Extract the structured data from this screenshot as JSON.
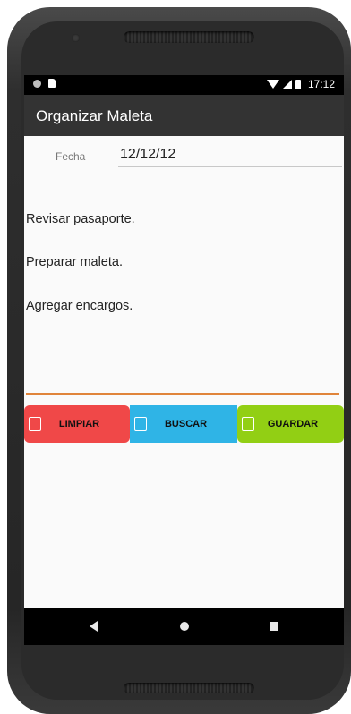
{
  "status_bar": {
    "time": "17:12"
  },
  "app_bar": {
    "title": "Organizar Maleta"
  },
  "form": {
    "fecha_label": "Fecha",
    "fecha_value": "12/12/12",
    "notes_lines": [
      "Revisar pasaporte.",
      "Preparar maleta.",
      "Agregar encargos."
    ]
  },
  "buttons": {
    "limpiar": "LIMPIAR",
    "buscar": "BUSCAR",
    "guardar": "GUARDAR"
  },
  "colors": {
    "app_bar": "#333333",
    "limpiar": "#f04848",
    "buscar": "#2fb4e6",
    "guardar": "#92cf14",
    "accent_underline": "#e0843a"
  }
}
